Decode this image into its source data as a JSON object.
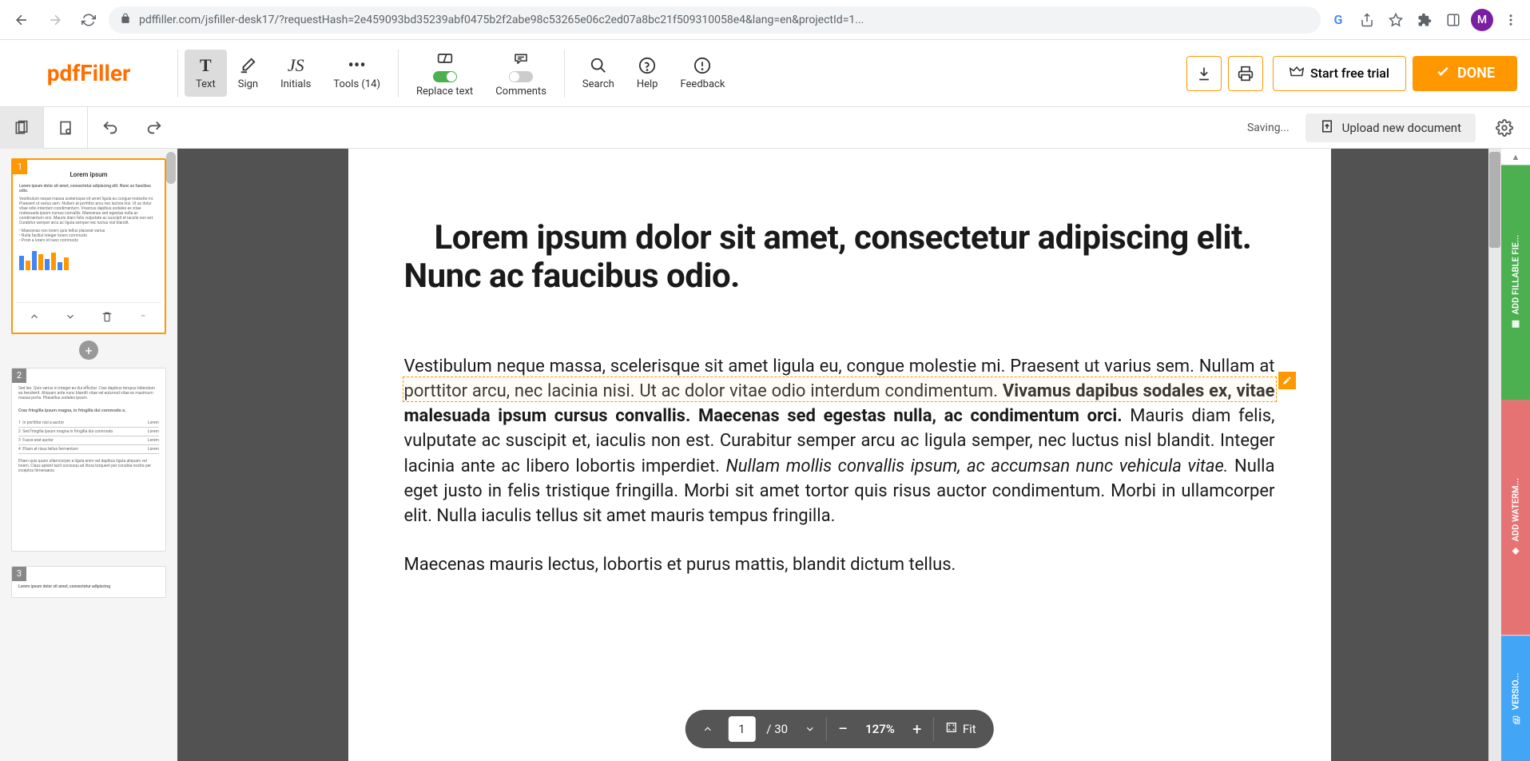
{
  "browser": {
    "url": "pdffiller.com/jsfiller-desk17/?requestHash=2e459093bd35239abf0475b2f2abe98c53265e06c2ed07a8bc21f509310058e4&lang=en&projectId=1...",
    "avatar": "M"
  },
  "logo": "pdfFiller",
  "toolbar": {
    "text": "Text",
    "sign": "Sign",
    "initials": "Initials",
    "tools": "Tools (14)",
    "replace": "Replace text",
    "comments": "Comments",
    "search": "Search",
    "help": "Help",
    "feedback": "Feedback",
    "trial": "Start free trial",
    "done": "DONE"
  },
  "sec": {
    "saving": "Saving...",
    "upload": "Upload new document"
  },
  "thumbs": {
    "p1": "Lorem ipsum",
    "p1num": "1",
    "p2num": "2",
    "p3num": "3"
  },
  "doc": {
    "heading": "Lorem ipsum dolor sit amet, consectetur adipiscing elit. Nunc ac faucibus odio.",
    "p1_a": "Vestibulum neque massa, scelerisque sit amet ligula eu, congue molestie mi. Praesent ut varius sem. Nullam at porttitor arcu, nec lacinia nisi. Ut ac dolor vitae odio interdum condimentum. ",
    "p1_b": "Vivamus dapibus sodales ex, vitae malesuada ipsum cursus convallis. Maecenas sed egestas nulla, ac condimentum orci.",
    "p1_c": " Mauris diam felis, vulputate ac suscipit et, iaculis non est. Curabitur semper arcu ac ligula semper, nec luctus nisl blandit. Integer lacinia ante ac libero lobortis imperdiet. ",
    "p1_d": "Nullam mollis convallis ipsum, ac accumsan nunc vehicula vitae.",
    "p1_e": " Nulla eget justo in felis tristique fringilla. Morbi sit amet tortor quis risus auctor condimentum. Morbi in ullamcorper elit. Nulla iaculis tellus sit amet mauris tempus fringilla.",
    "p2": "Maecenas mauris lectus, lobortis et purus mattis, blandit dictum tellus."
  },
  "bottombar": {
    "page": "1",
    "total": "/ 30",
    "zoom": "127%",
    "fit": "Fit"
  },
  "rail": {
    "fillable": "ADD FILLABLE FIE...",
    "watermark": "ADD WATERM...",
    "version": "VERSIO..."
  }
}
